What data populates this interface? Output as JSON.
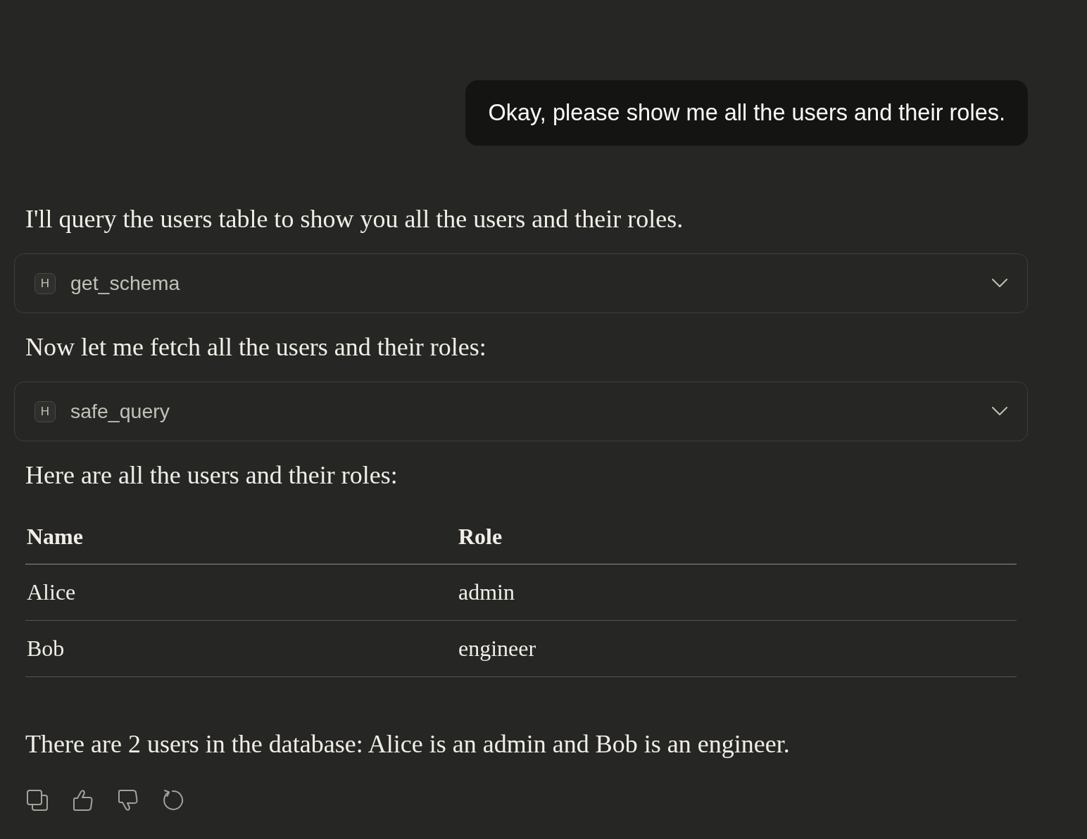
{
  "conversation": [
    {
      "kind": "user",
      "text": "Okay, please show me all the users and their roles."
    },
    {
      "kind": "paragraph",
      "text": "I'll query the users table to show you all the users and their roles."
    },
    {
      "kind": "tool",
      "badge": "H",
      "name": "get_schema",
      "expanded": false
    },
    {
      "kind": "paragraph",
      "text": "Now let me fetch all the users and their roles:"
    },
    {
      "kind": "tool",
      "badge": "H",
      "name": "safe_query",
      "expanded": false
    },
    {
      "kind": "paragraph",
      "text": "Here are all the users and their roles:"
    },
    {
      "kind": "table",
      "columns": [
        "Name",
        "Role"
      ],
      "rows": [
        [
          "Alice",
          "admin"
        ],
        [
          "Bob",
          "engineer"
        ]
      ]
    },
    {
      "kind": "paragraph",
      "text": "There are 2 users in the database: Alice is an admin and Bob is an engineer."
    }
  ]
}
